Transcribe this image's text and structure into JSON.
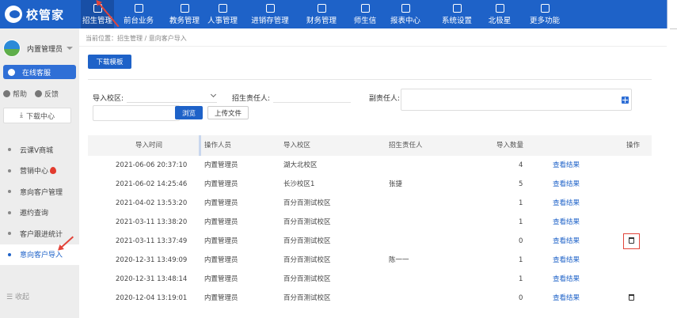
{
  "app": {
    "logo_text": "校管家"
  },
  "topnav": [
    {
      "label": "招生管理",
      "icon": "user-add-icon",
      "active": true
    },
    {
      "label": "前台业务",
      "icon": "front-desk-icon"
    },
    {
      "label": "教务管理",
      "icon": "book-icon"
    },
    {
      "label": "人事管理",
      "icon": "person-icon"
    },
    {
      "label": "进销存管理",
      "icon": "inventory-icon"
    },
    {
      "label": "财务管理",
      "icon": "finance-icon"
    },
    {
      "label": "师生信",
      "icon": "message-icon"
    },
    {
      "label": "报表中心",
      "icon": "report-icon"
    },
    {
      "label": "系统设置",
      "icon": "settings-icon"
    },
    {
      "label": "北极星",
      "icon": "star-icon"
    },
    {
      "label": "更多功能",
      "icon": "more-icon"
    }
  ],
  "sidebar": {
    "user_name": "内置管理员",
    "online_service": "在线客服",
    "help": "帮助",
    "feedback": "反馈",
    "download_center": "下载中心",
    "menu": [
      {
        "label": "云课V商城"
      },
      {
        "label": "营销中心"
      },
      {
        "label": "意向客户管理"
      },
      {
        "label": "邀约查询"
      },
      {
        "label": "客户跟进统计"
      },
      {
        "label": "意向客户导入",
        "active": true
      }
    ],
    "collapse_label": "收起"
  },
  "breadcrumb": "当前位置：招生管理 / 意向客户导入",
  "download_template": "下载模板",
  "form": {
    "import_campus_label": "导入校区:",
    "owner_label": "招生责任人:",
    "deputy_label": "副责任人:",
    "browse": "浏览",
    "upload": "上传文件"
  },
  "table": {
    "headers": [
      "导入时间",
      "操作人员",
      "导入校区",
      "招生责任人",
      "导入数量",
      "操作"
    ],
    "view_label": "查看结果",
    "rows": [
      {
        "time": "2021-06-06 20:37:10",
        "operator": "内置管理员",
        "campus": "湖大北校区",
        "owner": "",
        "count": "4",
        "delete": false
      },
      {
        "time": "2021-06-02 14:25:46",
        "operator": "内置管理员",
        "campus": "长沙校区1",
        "owner": "张捷",
        "count": "5",
        "delete": false
      },
      {
        "time": "2021-04-02 13:53:20",
        "operator": "内置管理员",
        "campus": "百分百测试校区",
        "owner": "",
        "count": "1",
        "delete": false
      },
      {
        "time": "2021-03-11 13:38:20",
        "operator": "内置管理员",
        "campus": "百分百测试校区",
        "owner": "",
        "count": "1",
        "delete": false
      },
      {
        "time": "2021-03-11 13:37:49",
        "operator": "内置管理员",
        "campus": "百分百测试校区",
        "owner": "",
        "count": "0",
        "delete": true,
        "highlight": true
      },
      {
        "time": "2020-12-31 13:49:09",
        "operator": "内置管理员",
        "campus": "百分百测试校区",
        "owner": "陈一一",
        "count": "1",
        "delete": false
      },
      {
        "time": "2020-12-31 13:48:14",
        "operator": "内置管理员",
        "campus": "百分百测试校区",
        "owner": "",
        "count": "1",
        "delete": false
      },
      {
        "time": "2020-12-04 13:19:01",
        "operator": "内置管理员",
        "campus": "百分百测试校区",
        "owner": "",
        "count": "0",
        "delete": true
      }
    ]
  },
  "colors": {
    "primary": "#1e62c8",
    "annotation": "#e2443a",
    "sidebar_bg": "#ededed"
  }
}
